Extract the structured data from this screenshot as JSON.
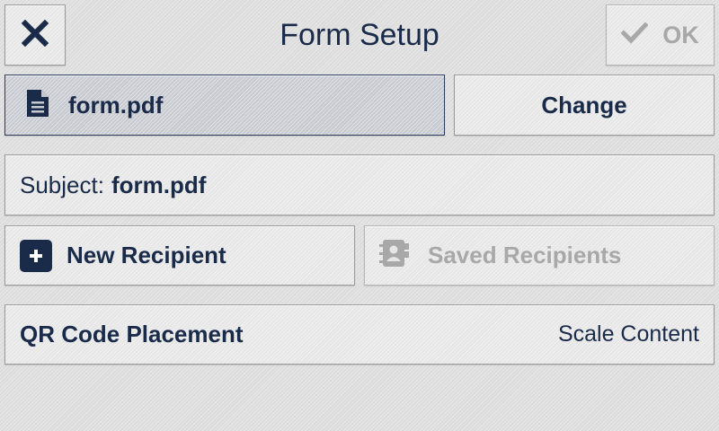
{
  "header": {
    "title": "Form Setup",
    "ok_label": "OK"
  },
  "file": {
    "name": "form.pdf",
    "change_label": "Change"
  },
  "subject": {
    "label": "Subject:",
    "value": "form.pdf"
  },
  "recipients": {
    "new_label": "New Recipient",
    "saved_label": "Saved Recipients"
  },
  "qr": {
    "label": "QR Code Placement",
    "value": "Scale Content"
  },
  "icons": {
    "close": "close-icon",
    "ok": "checkmark-icon",
    "file": "document-icon",
    "add": "plus-icon",
    "contacts": "address-book-icon"
  },
  "colors": {
    "primary": "#1a2b4a",
    "disabled": "#a8a8a8",
    "selected_bg": "#c6c9cf"
  }
}
